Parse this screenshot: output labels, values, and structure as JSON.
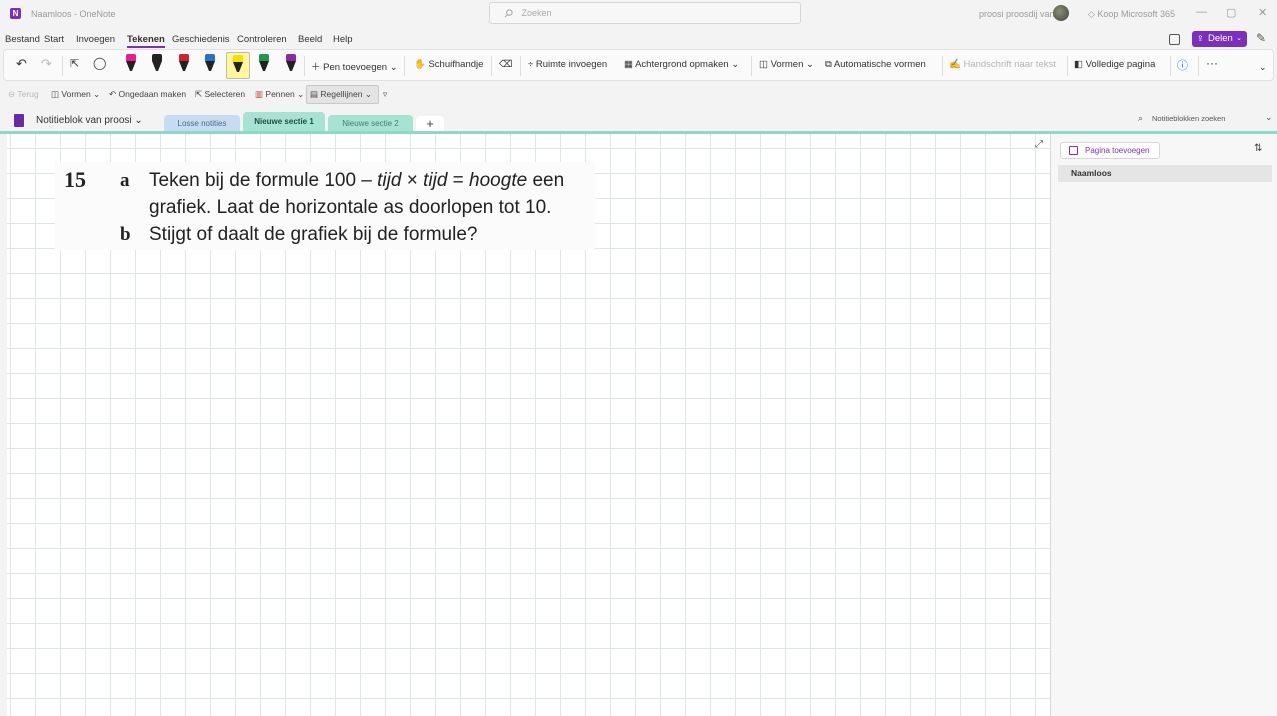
{
  "titlebar": {
    "app_title": "Naamloos - OneNote",
    "search_placeholder": "Zoeken",
    "user_name": "proosi proosdij van",
    "buy_label": "Koop Microsoft 365",
    "minimize": "—",
    "restore": "▢",
    "close": "✕"
  },
  "menu": {
    "items": [
      "Bestand",
      "Start",
      "Invoegen",
      "Tekenen",
      "Geschiedenis",
      "Controleren",
      "Beeld",
      "Help"
    ],
    "active": "Tekenen",
    "share_label": "Delen"
  },
  "ribbon": {
    "add_pen": "Pen toevoegen",
    "hand": "Schuifhandje",
    "insert_space": "Ruimte invoegen",
    "format_background": "Achtergrond opmaken",
    "shapes": "Vormen",
    "auto_shapes": "Automatische vormen",
    "ink_to_text": "Handschrift naar tekst",
    "full_page": "Volledige pagina",
    "pen_colors": [
      "#e91e8c",
      "#222222",
      "#d0202a",
      "#2a6fd0",
      "#f5e000",
      "#1a9a4a",
      "#8a2aa8"
    ],
    "highlighter_color": "#fff200"
  },
  "subribbon": {
    "back": "Terug",
    "shapes": "Vormen",
    "undo": "Ongedaan maken",
    "select": "Selecteren",
    "pens": "Pennen",
    "rule_lines": "Regellijnen"
  },
  "notebook": {
    "name": "Notitieblok van proosi",
    "sections": [
      {
        "label": "Losse notities",
        "color": "#c7dcf0"
      },
      {
        "label": "Nieuwe sectie 1",
        "color": "#a7e3d3"
      },
      {
        "label": "Nieuwe sectie 2",
        "color": "#a7e3d3"
      }
    ],
    "add_section": "+",
    "search_placeholder": "Notitieblokken zoeken"
  },
  "exercise": {
    "number": "15",
    "part_a_label": "a",
    "part_a_line1_pre": "Teken bij de formule 100 – ",
    "part_a_tijd1": "tijd",
    "part_a_times": " × ",
    "part_a_tijd2": "tijd",
    "part_a_eq": " = ",
    "part_a_hoogte": "hoogte",
    "part_a_line1_post": " een",
    "part_a_line2": "grafiek. Laat de horizontale as doorlopen tot 10.",
    "part_b_label": "b",
    "part_b_text": "Stijgt of daalt de grafiek bij de formule?"
  },
  "pages": {
    "add_page": "Pagina toevoegen",
    "items": [
      "Naamloos"
    ]
  }
}
